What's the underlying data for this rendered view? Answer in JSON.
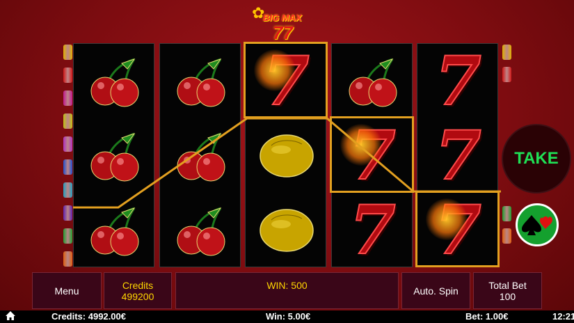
{
  "logo": {
    "brand": "BIG MAX",
    "number": "77"
  },
  "reels": [
    [
      "cherry-icon",
      "cherry-icon",
      "cherry-icon"
    ],
    [
      "cherry-icon",
      "cherry-icon",
      "cherry-icon"
    ],
    [
      "seven-icon",
      "lemon-icon",
      "lemon-icon"
    ],
    [
      "cherry-icon",
      "seven-icon",
      "seven-icon"
    ],
    [
      "seven-icon",
      "seven-icon",
      "seven-icon"
    ]
  ],
  "symbols": {
    "seven": "7"
  },
  "buttons": {
    "take": "TAKE",
    "menu": "Menu",
    "credits_label": "Credits",
    "credits_value": "499200",
    "win_label": "WIN: 500",
    "auto_spin": "Auto. Spin",
    "total_bet_label": "Total Bet",
    "total_bet_value": "100"
  },
  "status_bar": {
    "credits": "Credits: 4992.00€",
    "win": "Win: 5.00€",
    "bet": "Bet: 1.00€",
    "time": "12:21"
  },
  "colors": {
    "win_frame": "#e3a020",
    "take_text": "#1fe055",
    "credits_accent": "#ffd700",
    "line_markers_left": [
      "#e0b000",
      "#d01818",
      "#c01890",
      "#c0c010",
      "#b030c0",
      "#2050d0",
      "#20a0c0",
      "#6020b0",
      "#20a030",
      "#e06010"
    ],
    "line_markers_right": [
      "#e0b000",
      "#d01818",
      "#20a030",
      "#e06010"
    ]
  }
}
